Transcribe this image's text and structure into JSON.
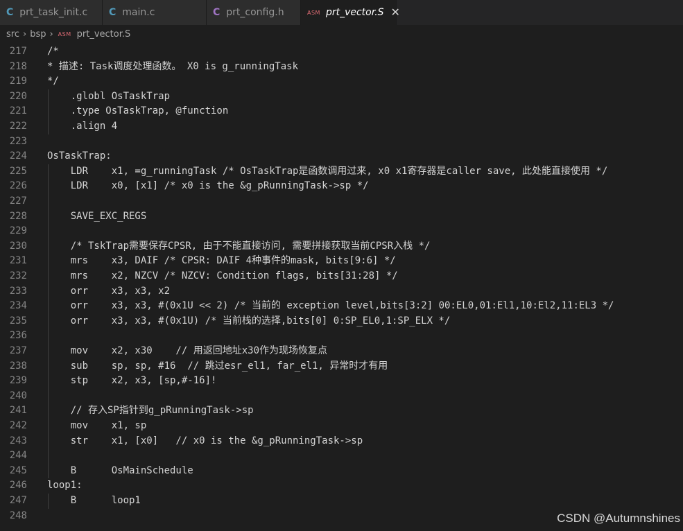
{
  "tabs": [
    {
      "label": "prt_task_init.c",
      "icon": "c-file-icon",
      "glyph": "C",
      "active": false
    },
    {
      "label": "main.c",
      "icon": "c-file-icon",
      "glyph": "C",
      "active": false
    },
    {
      "label": "prt_config.h",
      "icon": "c-header-icon",
      "glyph": "C",
      "active": false
    },
    {
      "label": "prt_vector.S",
      "icon": "asm-file-icon",
      "glyph": "ASM",
      "active": true
    }
  ],
  "breadcrumb": [
    "src",
    "bsp",
    "prt_vector.S"
  ],
  "breadcrumb_icon": "ASM",
  "colors": {
    "background": "#1e1e1e",
    "tabbar": "#252526",
    "line_number": "#858585",
    "text": "#d4d4d4"
  },
  "lines": [
    {
      "n": "217",
      "t": "/*"
    },
    {
      "n": "218",
      "t": "* 描述: Task调度处理函数。 X0 is g_runningTask"
    },
    {
      "n": "219",
      "t": "*/"
    },
    {
      "n": "220",
      "t": "    .globl OsTaskTrap"
    },
    {
      "n": "221",
      "t": "    .type OsTaskTrap, @function"
    },
    {
      "n": "222",
      "t": "    .align 4"
    },
    {
      "n": "223",
      "t": ""
    },
    {
      "n": "224",
      "t": "OsTaskTrap:"
    },
    {
      "n": "225",
      "t": "    LDR    x1, =g_runningTask /* OsTaskTrap是函数调用过来, x0 x1寄存器是caller save, 此处能直接使用 */"
    },
    {
      "n": "226",
      "t": "    LDR    x0, [x1] /* x0 is the &g_pRunningTask->sp */"
    },
    {
      "n": "227",
      "t": ""
    },
    {
      "n": "228",
      "t": "    SAVE_EXC_REGS"
    },
    {
      "n": "229",
      "t": ""
    },
    {
      "n": "230",
      "t": "    /* TskTrap需要保存CPSR, 由于不能直接访问, 需要拼接获取当前CPSR入栈 */"
    },
    {
      "n": "231",
      "t": "    mrs    x3, DAIF /* CPSR: DAIF 4种事件的mask, bits[9:6] */"
    },
    {
      "n": "232",
      "t": "    mrs    x2, NZCV /* NZCV: Condition flags, bits[31:28] */"
    },
    {
      "n": "233",
      "t": "    orr    x3, x3, x2"
    },
    {
      "n": "234",
      "t": "    orr    x3, x3, #(0x1U << 2) /* 当前的 exception level,bits[3:2] 00:EL0,01:El1,10:El2,11:EL3 */"
    },
    {
      "n": "235",
      "t": "    orr    x3, x3, #(0x1U) /* 当前栈的选择,bits[0] 0:SP_EL0,1:SP_ELX */"
    },
    {
      "n": "236",
      "t": ""
    },
    {
      "n": "237",
      "t": "    mov    x2, x30    // 用返回地址x30作为现场恢复点"
    },
    {
      "n": "238",
      "t": "    sub    sp, sp, #16  // 跳过esr_el1, far_el1, 异常时才有用"
    },
    {
      "n": "239",
      "t": "    stp    x2, x3, [sp,#-16]!"
    },
    {
      "n": "240",
      "t": ""
    },
    {
      "n": "241",
      "t": "    // 存入SP指针到g_pRunningTask->sp"
    },
    {
      "n": "242",
      "t": "    mov    x1, sp"
    },
    {
      "n": "243",
      "t": "    str    x1, [x0]   // x0 is the &g_pRunningTask->sp"
    },
    {
      "n": "244",
      "t": ""
    },
    {
      "n": "245",
      "t": "    B      OsMainSchedule"
    },
    {
      "n": "246",
      "t": "loop1:"
    },
    {
      "n": "247",
      "t": "    B      loop1"
    },
    {
      "n": "248",
      "t": ""
    }
  ],
  "watermark": "CSDN @Autumnshines"
}
